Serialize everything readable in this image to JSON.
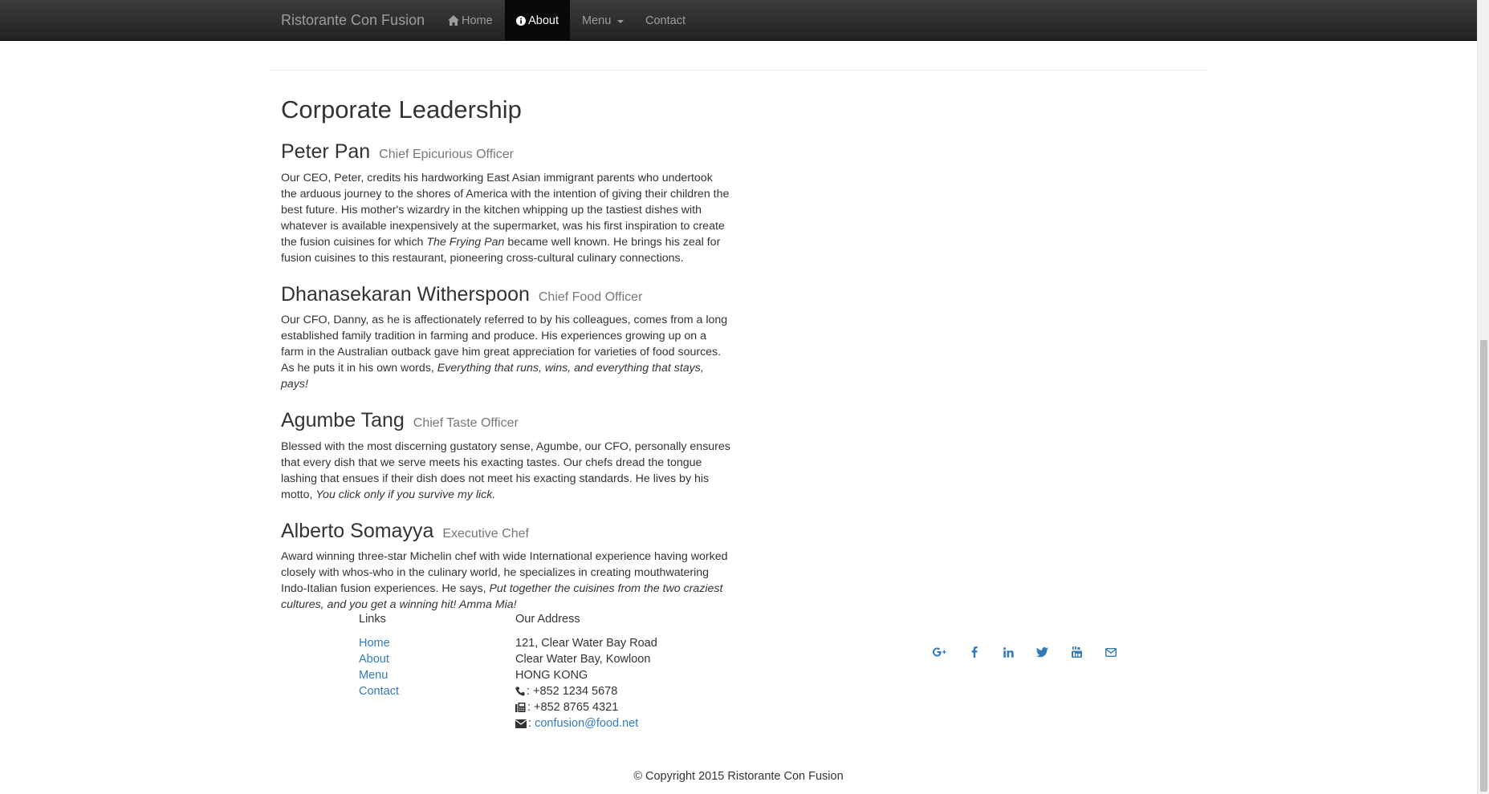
{
  "nav": {
    "brand": "Ristorante Con Fusion",
    "items": [
      {
        "label": "Home"
      },
      {
        "label": "About"
      },
      {
        "label": "Menu"
      },
      {
        "label": "Contact"
      }
    ]
  },
  "main": {
    "title": "Corporate Leadership",
    "leaders": [
      {
        "name": "Peter Pan",
        "role": "Chief Epicurious Officer",
        "text1": "Our CEO, Peter, credits his hardworking East Asian immigrant parents who undertook the arduous journey to the shores of America with the intention of giving their children the best future. His mother's wizardry in the kitchen whipping up the tastiest dishes with whatever is available inexpensively at the supermarket, was his first inspiration to create the fusion cuisines for which ",
        "em": "The Frying Pan",
        "text2": " became well known. He brings his zeal for fusion cuisines to this restaurant, pioneering cross-cultural culinary connections."
      },
      {
        "name": "Dhanasekaran Witherspoon",
        "role": "Chief Food Officer",
        "text1": "Our CFO, Danny, as he is affectionately referred to by his colleagues, comes from a long established family tradition in farming and produce. His experiences growing up on a farm in the Australian outback gave him great appreciation for varieties of food sources. As he puts it in his own words, ",
        "em": "Everything that runs, wins, and everything that stays, pays!",
        "text2": ""
      },
      {
        "name": "Agumbe Tang",
        "role": "Chief Taste Officer",
        "text1": "Blessed with the most discerning gustatory sense, Agumbe, our CFO, personally ensures that every dish that we serve meets his exacting tastes. Our chefs dread the tongue lashing that ensues if their dish does not meet his exacting standards. He lives by his motto, ",
        "em": "You click only if you survive my lick.",
        "text2": ""
      },
      {
        "name": "Alberto Somayya",
        "role": "Executive Chef",
        "text1": "Award winning three-star Michelin chef with wide International experience having worked closely with whos-who in the culinary world, he specializes in creating mouthwatering Indo-Italian fusion experiences. He says, ",
        "em": "Put together the cuisines from the two craziest cultures, and you get a winning hit! Amma Mia!",
        "text2": ""
      }
    ]
  },
  "footer": {
    "links_heading": "Links",
    "links": [
      "Home",
      "About",
      "Menu",
      "Contact"
    ],
    "address_heading": "Our Address",
    "address_line1": "121, Clear Water Bay Road",
    "address_line2": "Clear Water Bay, Kowloon",
    "address_line3": "HONG KONG",
    "phone": ": +852 1234 5678",
    "fax": ": +852 8765 4321",
    "email_prefix": ": ",
    "email": "confusion@food.net",
    "social_icons": [
      "google-plus-icon",
      "facebook-icon",
      "linkedin-icon",
      "twitter-icon",
      "youtube-icon",
      "envelope-icon"
    ],
    "copyright": "© Copyright 2015 Ristorante Con Fusion"
  },
  "colors": {
    "navbar": "#222222",
    "link": "#337ab7",
    "muted": "#777777",
    "text": "#333333"
  }
}
